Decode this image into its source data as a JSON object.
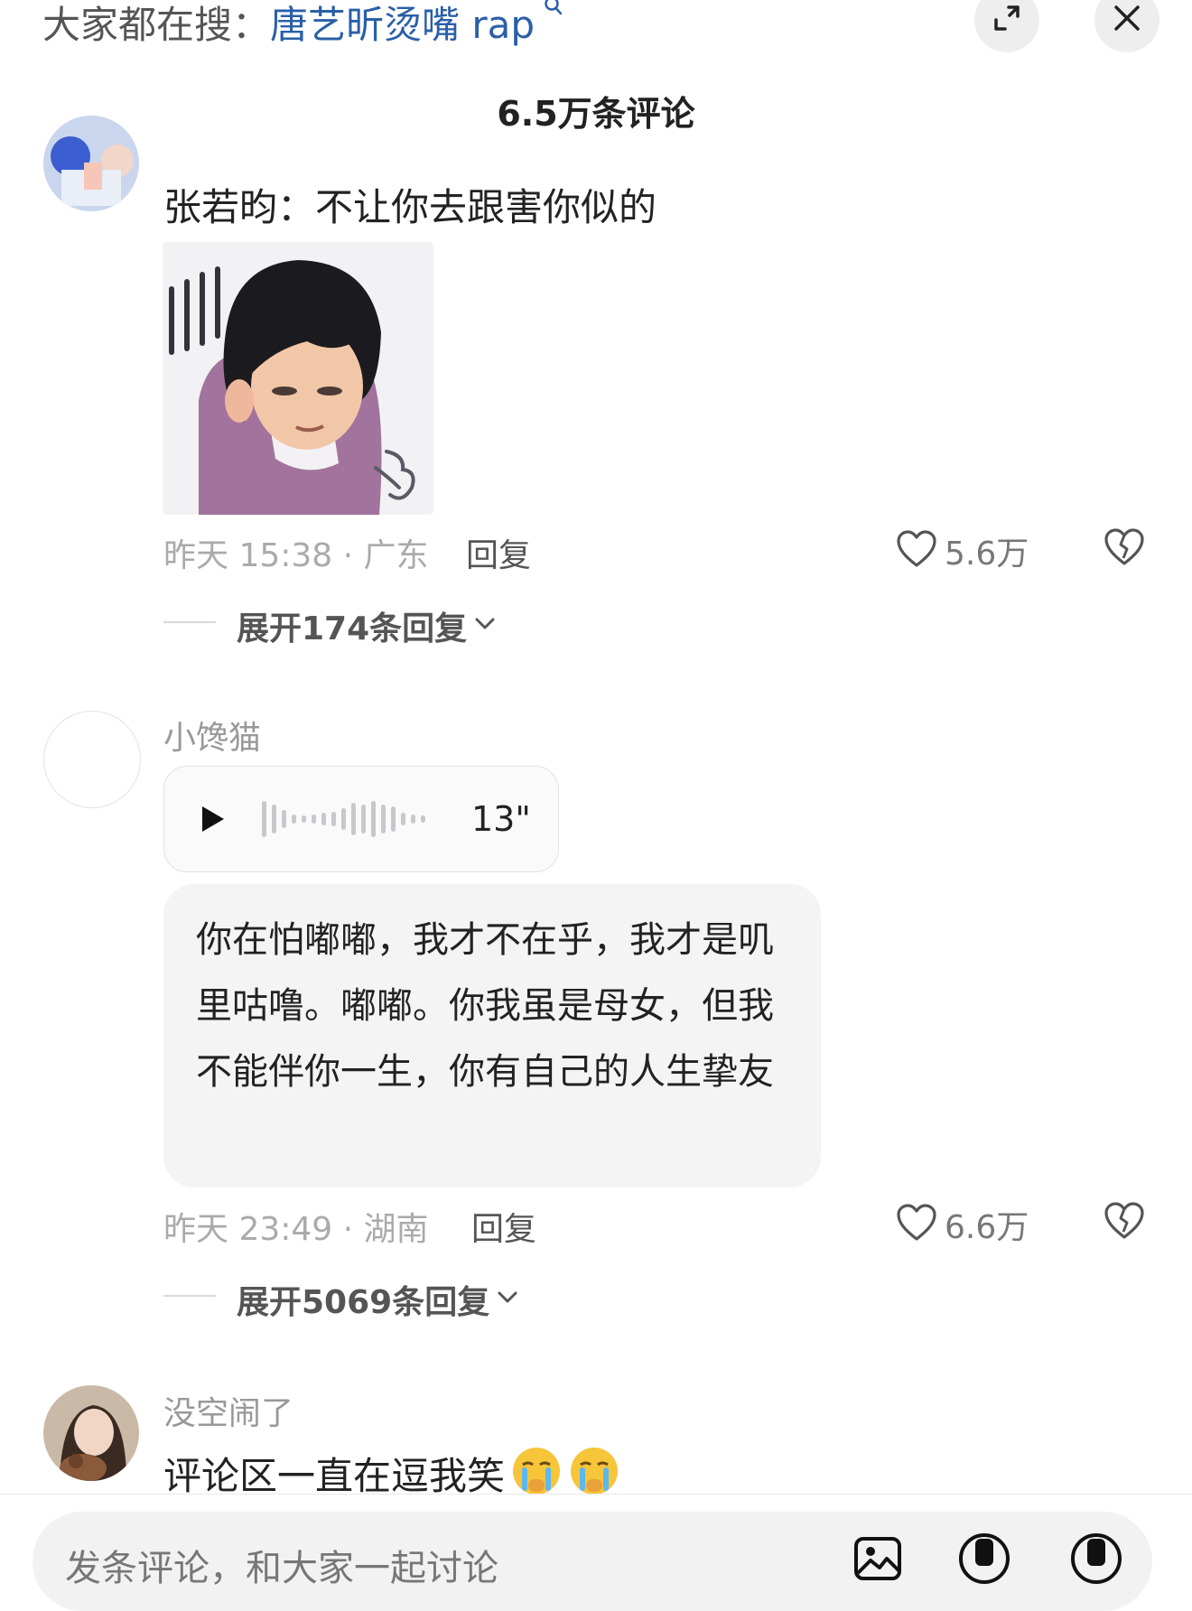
{
  "header": {
    "search_prefix": "大家都在搜：",
    "search_query": "唐艺昕烫嘴 rap",
    "comment_count": "6.5万条评论"
  },
  "comments": [
    {
      "text": "张若昀：不让你去跟害你似的",
      "time_location": "昨天 15:38 · 广东",
      "reply_label": "回复",
      "likes": "5.6万",
      "expand_label": "展开174条回复"
    },
    {
      "username": "小馋猫",
      "voice_duration": "13\"",
      "voice_text": "你在怕嘟嘟，我才不在乎，我才是叽里咕噜。嘟嘟。你我虽是母女，但我不能伴你一生，你有自己的人生挚友",
      "time_location": "昨天 23:49 · 湖南",
      "reply_label": "回复",
      "likes": "6.6万",
      "expand_label": "展开5069条回复"
    },
    {
      "username": "没空闹了",
      "text": "评论区一直在逗我笑"
    }
  ],
  "input": {
    "placeholder": "发条评论，和大家一起讨论"
  },
  "colors": {
    "search_query": "#2a5fa8",
    "meta": "#aaaaaa",
    "bubble_bg": "#f4f4f4"
  },
  "icons": [
    "search-icon",
    "expand-icon",
    "close-icon",
    "heart-icon",
    "broken-heart-icon",
    "chevron-down-icon",
    "play-icon",
    "image-icon",
    "emoji-icon",
    "crying-emoji-icon"
  ]
}
